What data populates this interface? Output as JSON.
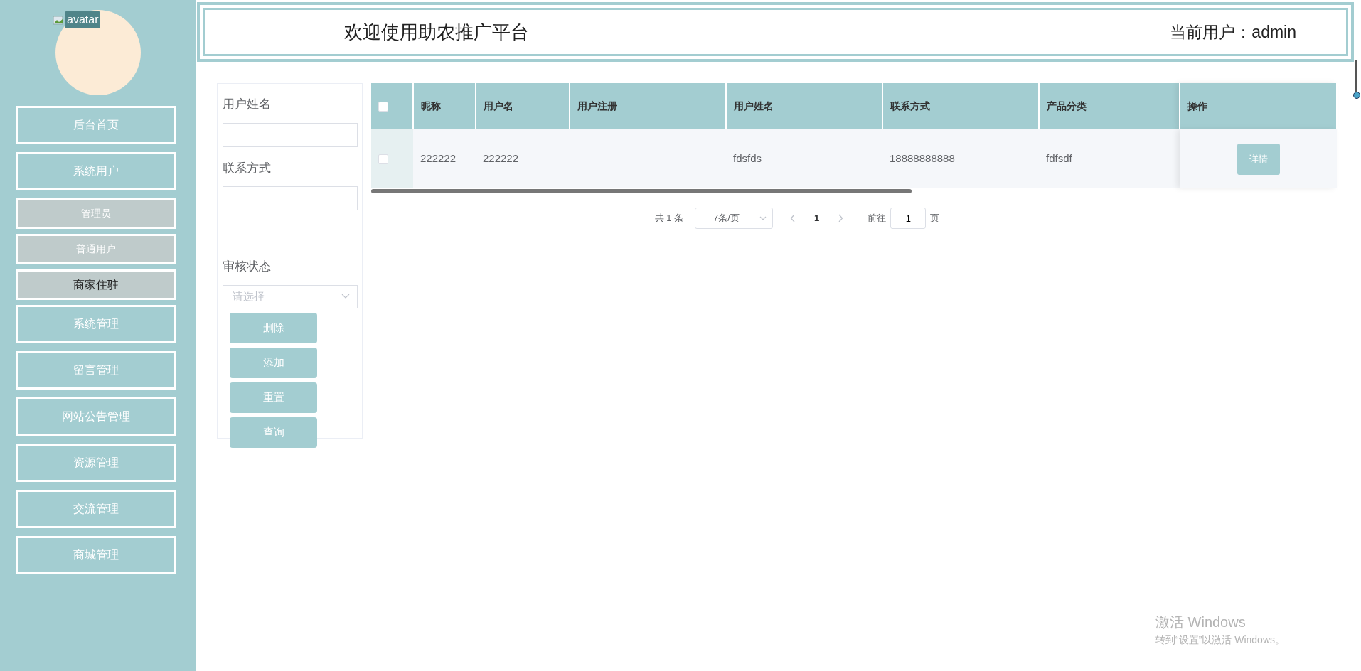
{
  "sidebar": {
    "avatar": {
      "alt_text": "avatar"
    },
    "items": [
      {
        "label": "后台首页",
        "kind": "main",
        "selected": false
      },
      {
        "label": "系统用户",
        "kind": "main",
        "selected": false
      },
      {
        "label": "管理员",
        "kind": "sub",
        "selected": false
      },
      {
        "label": "普通用户",
        "kind": "sub",
        "selected": false
      },
      {
        "label": "商家住驻",
        "kind": "sub",
        "selected": true
      },
      {
        "label": "系统管理",
        "kind": "main",
        "selected": false
      },
      {
        "label": "留言管理",
        "kind": "main",
        "selected": false
      },
      {
        "label": "网站公告管理",
        "kind": "main",
        "selected": false
      },
      {
        "label": "资源管理",
        "kind": "main",
        "selected": false
      },
      {
        "label": "交流管理",
        "kind": "main",
        "selected": false
      },
      {
        "label": "商城管理",
        "kind": "main",
        "selected": false
      }
    ]
  },
  "header": {
    "title": "欢迎使用助农推广平台",
    "user_label": "当前用户：admin"
  },
  "filters": {
    "fields": [
      {
        "label": "用户姓名",
        "kind": "text"
      },
      {
        "label": "联系方式",
        "kind": "text"
      },
      {
        "label": "审核状态",
        "kind": "select",
        "placeholder": "请选择"
      }
    ],
    "buttons": [
      "删除",
      "添加",
      "重置",
      "查询"
    ]
  },
  "table": {
    "header_checkbox": {
      "checked": false
    },
    "columns": [
      "昵称",
      "用户名",
      "用户注册",
      "用户姓名",
      "联系方式",
      "产品分类",
      "操作"
    ],
    "rows": [
      {
        "checked": false,
        "cells": [
          "222222",
          "222222",
          null,
          "fdsfds",
          "18888888888",
          "fdfsdf"
        ],
        "action": "详情"
      }
    ]
  },
  "pagination": {
    "total": "共 1 条",
    "page_size": "7条/页",
    "pages": [
      {
        "label": "1",
        "selected": true
      }
    ],
    "goto_label": "前往",
    "goto_value": "1",
    "page_suffix": "页"
  },
  "os_watermark": {
    "title": "激活 Windows",
    "subtitle": "转到“设置”以激活 Windows。"
  }
}
